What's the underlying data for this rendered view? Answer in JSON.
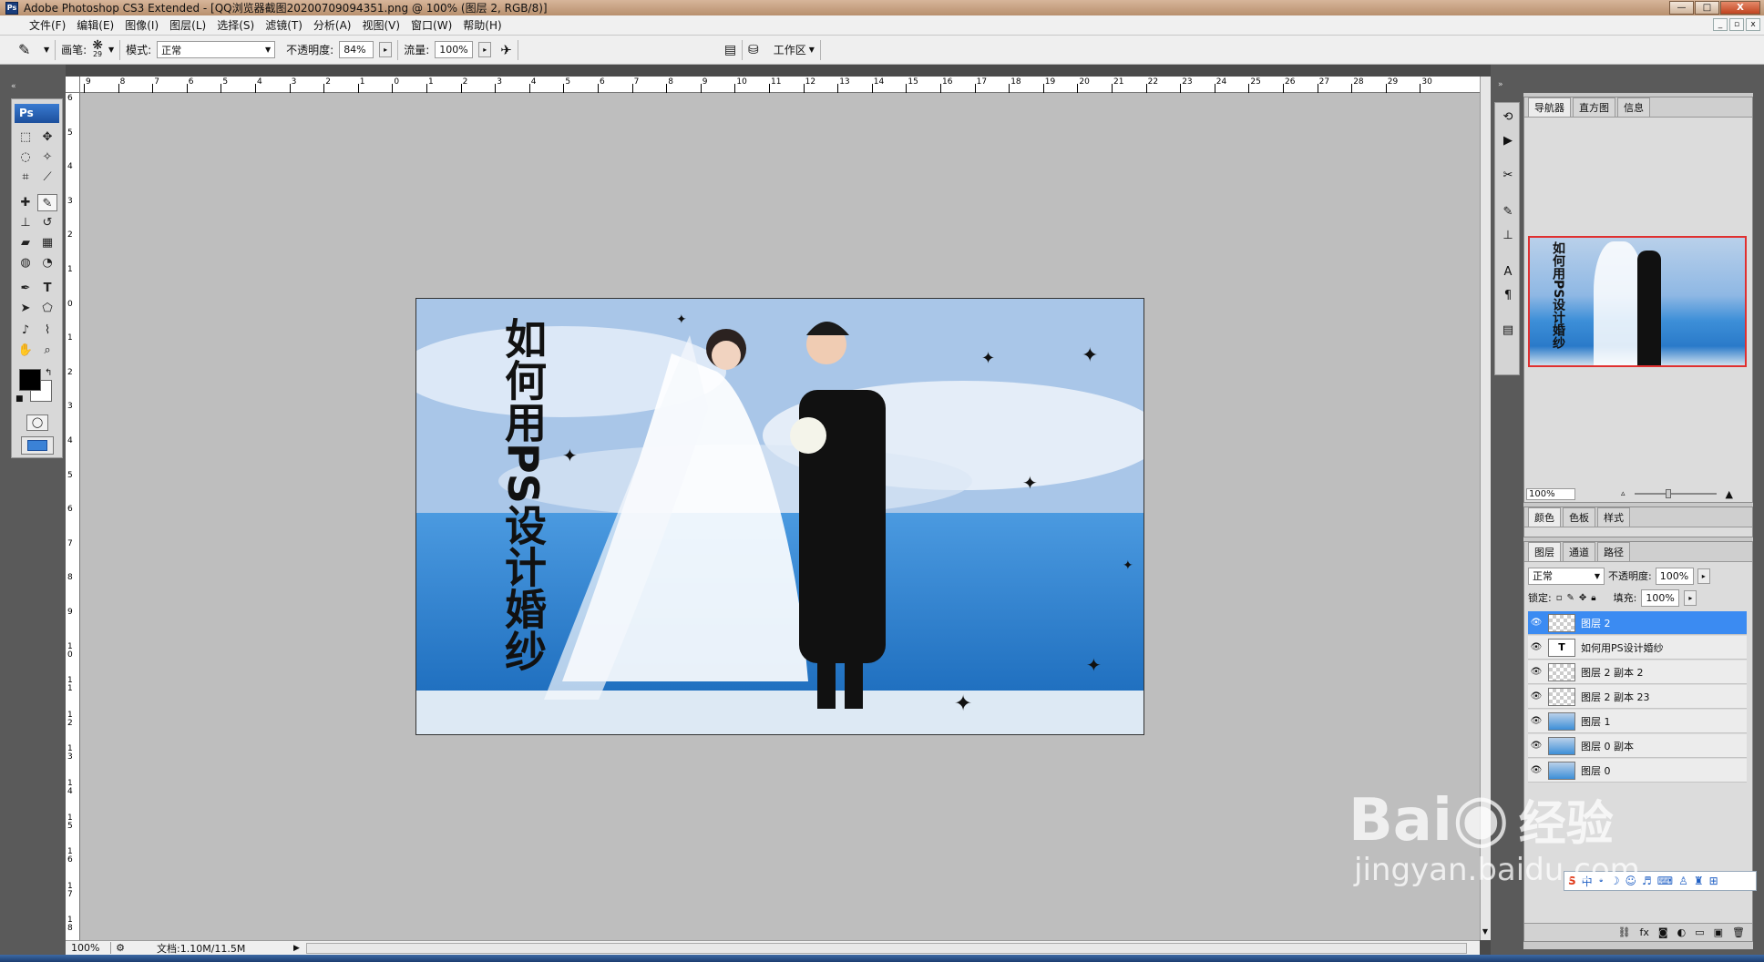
{
  "window": {
    "title": "Adobe Photoshop CS3 Extended - [QQ浏览器截图20200709094351.png @ 100% (图层 2, RGB/8)]",
    "app_badge": "Ps",
    "controls": {
      "minimize": "—",
      "maximize": "□",
      "close": "X"
    }
  },
  "menubar": {
    "items": [
      "文件(F)",
      "编辑(E)",
      "图像(I)",
      "图层(L)",
      "选择(S)",
      "滤镜(T)",
      "分析(A)",
      "视图(V)",
      "窗口(W)",
      "帮助(H)"
    ]
  },
  "options_bar": {
    "brush_label": "画笔:",
    "brush_size": "29",
    "mode_label": "模式:",
    "mode_value": "正常",
    "opacity_label": "不透明度:",
    "opacity_value": "84%",
    "flow_label": "流量:",
    "flow_value": "100%",
    "workspace_label": "工作区"
  },
  "toolbox": {
    "header": "Ps"
  },
  "rulers": {
    "top_labels": [
      "9",
      "8",
      "7",
      "6",
      "5",
      "4",
      "3",
      "2",
      "1",
      "0",
      "1",
      "2",
      "3",
      "4",
      "5",
      "6",
      "7",
      "8",
      "9",
      "10",
      "11",
      "12",
      "13",
      "14",
      "15",
      "16",
      "17",
      "18",
      "19",
      "20",
      "21",
      "22",
      "23",
      "24",
      "25",
      "26",
      "27",
      "28",
      "29",
      "30"
    ],
    "left_labels": [
      "6",
      "5",
      "4",
      "3",
      "2",
      "1",
      "0",
      "1",
      "2",
      "3",
      "4",
      "5",
      "6",
      "7",
      "8",
      "9",
      "10",
      "11",
      "12",
      "13",
      "14",
      "15",
      "16",
      "17",
      "18"
    ]
  },
  "document": {
    "vertical_text": "如何用PS设计婚纱"
  },
  "statusbar": {
    "zoom": "100%",
    "doc_info": "文档:1.10M/11.5M"
  },
  "navigator": {
    "tabs": [
      "导航器",
      "直方图",
      "信息"
    ],
    "zoom": "100%",
    "thumbnail_text": "如何用PS设计婚纱"
  },
  "color_panel": {
    "tabs": [
      "颜色",
      "色板",
      "样式"
    ]
  },
  "layers_panel": {
    "tabs": [
      "图层",
      "通道",
      "路径"
    ],
    "blend_mode": "正常",
    "opacity_label": "不透明度:",
    "opacity_value": "100%",
    "lock_label": "锁定:",
    "fill_label": "填充:",
    "fill_value": "100%",
    "layers": [
      {
        "name": "图层 2",
        "type": "empty",
        "selected": true
      },
      {
        "name": "如何用PS设计婚纱",
        "type": "text",
        "selected": false
      },
      {
        "name": "图层 2 副本 2",
        "type": "empty",
        "selected": false
      },
      {
        "name": "图层 2 副本 23",
        "type": "empty",
        "selected": false
      },
      {
        "name": "图层 1",
        "type": "photo",
        "selected": false
      },
      {
        "name": "图层 0 副本",
        "type": "photo",
        "selected": false
      },
      {
        "name": "图层 0",
        "type": "photo",
        "selected": false
      }
    ]
  },
  "watermark": {
    "brand": "Bai",
    "brand_suffix": "经验",
    "url": "jingyan.baidu.com"
  },
  "ime_bar": {
    "label": "中"
  }
}
